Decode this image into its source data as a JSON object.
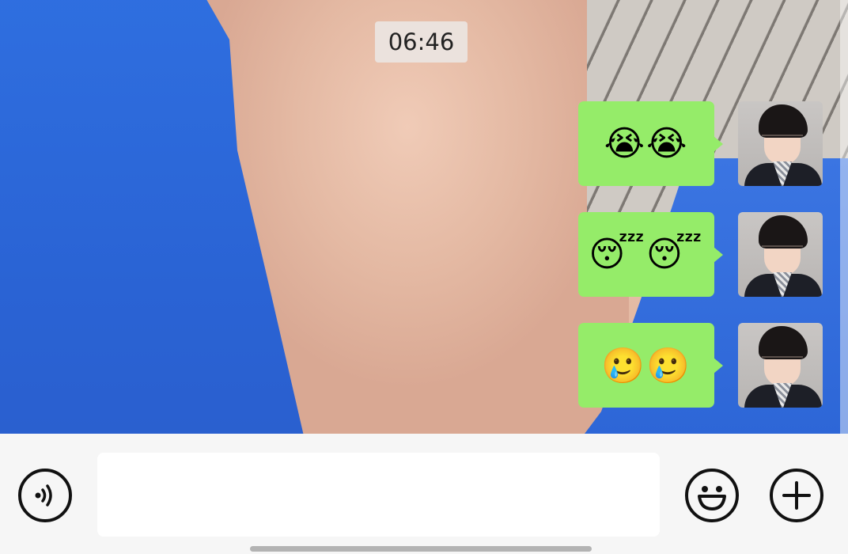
{
  "chat": {
    "timestamp": "06:46",
    "messages": [
      {
        "sender": "self",
        "content": "😭😭"
      },
      {
        "sender": "self",
        "content": "😴😴"
      },
      {
        "sender": "self",
        "content": "🥲🥲"
      }
    ]
  },
  "input_bar": {
    "voice_icon": "voice-icon",
    "message_value": "",
    "emoji_icon": "emoji-icon",
    "plus_icon": "plus-icon"
  },
  "colors": {
    "bubble_self": "#95ec69",
    "input_bar_bg": "#f6f6f6",
    "input_field_bg": "#ffffff"
  }
}
